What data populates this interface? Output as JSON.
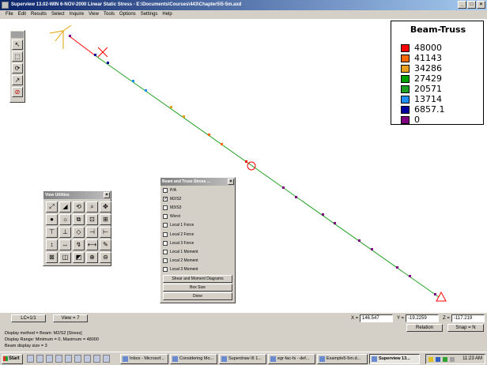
{
  "window": {
    "title": "Superview 13.02-WIN 6-NOV-2000 Linear Static Stress - E:\\Documents\\Courses\\443\\Chapter5\\5-5m.axd",
    "minimize": "_",
    "maximize": "□",
    "close": "×"
  },
  "menu": [
    "File",
    "Edit",
    "Results",
    "Select",
    "Inquire",
    "View",
    "Tools",
    "Options",
    "Settings",
    "Help"
  ],
  "legend": {
    "title": "Beam-Truss",
    "entries": [
      {
        "value": "48000",
        "color": "#ff0000"
      },
      {
        "value": "41143",
        "color": "#ff6a00"
      },
      {
        "value": "34286",
        "color": "#e8a020"
      },
      {
        "value": "27429",
        "color": "#00a000"
      },
      {
        "value": "20571",
        "color": "#20a020"
      },
      {
        "value": "13714",
        "color": "#2090ff"
      },
      {
        "value": "6857.1",
        "color": "#0000a0"
      },
      {
        "value": "0",
        "color": "#800080"
      }
    ]
  },
  "toolbar_icons": [
    "select-node-icon",
    "select-element-icon",
    "rotate-icon",
    "pan-icon",
    "deselect-icon"
  ],
  "view_utilities": {
    "title": "View Utilities",
    "close": "×",
    "icons": [
      "zoom-window-icon",
      "perspective-icon",
      "rotate-view-icon",
      "zoom-icon",
      "pan-view-icon",
      "shade-icon",
      "light-icon",
      "fit-icon",
      "view-front-icon",
      "view-side-icon",
      "view-top-icon",
      "view-bottom-icon",
      "view-iso-icon",
      "view-left-icon",
      "view-right-icon",
      "view-x-icon",
      "view-y-icon",
      "view-z-icon",
      "measure-icon",
      "annotate-icon",
      "scale-icon",
      "clip-icon",
      "section-icon",
      "zoom-in-icon",
      "zoom-out-icon"
    ]
  },
  "stress_panel": {
    "title": "Beam and Truss Stress ...",
    "close": "×",
    "options": [
      {
        "label": "P/A",
        "checked": false
      },
      {
        "label": "M2/S2",
        "checked": true
      },
      {
        "label": "M3/S3",
        "checked": false
      },
      {
        "label": "Worst",
        "checked": false
      },
      {
        "label": "Local 1 Force",
        "checked": false
      },
      {
        "label": "Local 2 Force",
        "checked": false
      },
      {
        "label": "Local 3 Force",
        "checked": false
      },
      {
        "label": "Local 1 Moment",
        "checked": false
      },
      {
        "label": "Local 2 Moment",
        "checked": false
      },
      {
        "label": "Local 3 Moment",
        "checked": false
      }
    ],
    "buttons": {
      "diagrams": "Shear and Moment Diagrams",
      "box_size": "Box Size",
      "done": "Done"
    }
  },
  "status": {
    "lc": "LC=1/1",
    "view": "View = 7",
    "x_label": "X =",
    "x_value": "146.547",
    "y_label": "Y =",
    "y_value": "-19.2259",
    "z_label": "Z =",
    "z_value": "-117.219",
    "relation": "Relation",
    "snap": "Snap = N",
    "messages": [
      "Display method = Beam: M2/S2  [Stress]",
      "Display Range: Minimum = 0, Maximum = 48000",
      "Beam display size = 3"
    ]
  },
  "taskbar": {
    "start": "Start",
    "tasks": [
      {
        "label": "Inbox - Microsof...",
        "active": false
      },
      {
        "label": "Considering Mo...",
        "active": false
      },
      {
        "label": "Superdraw III 1...",
        "active": false
      },
      {
        "label": "egr-fac-fs - def...",
        "active": false
      },
      {
        "label": "Example5-5m.d...",
        "active": false
      },
      {
        "label": "Superview 13...",
        "active": true
      }
    ],
    "clock": "11:23 AM"
  }
}
